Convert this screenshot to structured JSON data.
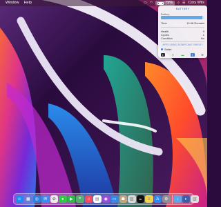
{
  "menubar": {
    "items": [
      "Window",
      "Help"
    ],
    "status": {
      "battery_percent_label": "79%",
      "battery_level": 0.79,
      "user_name": "Cory Wils"
    },
    "icons": [
      "screen-mirroring-icon",
      "wifi-icon",
      "battery-icon",
      "search-icon",
      "control-center-icon"
    ]
  },
  "battery_popover": {
    "title": "BATTERY",
    "charge_label": "Battery",
    "charge_level": 0.96,
    "time_label": "Time",
    "time_value": "10:46 Remaini",
    "health_label": "Health",
    "health_value": "9",
    "cycles_label": "Cycles",
    "cycles_value": "1",
    "condition_label": "Condition",
    "condition_value": "No",
    "link_label": "APPS USING SIGNIFICANT ENERGY",
    "app_name": "Safari",
    "toolbar": [
      "dark-mode-icon",
      "usb-icon",
      "battery-green-icon",
      "bluetooth-icon",
      "settings-icon"
    ]
  },
  "dock": {
    "apps": [
      {
        "name": "finder-icon",
        "color": "#1d8cf0"
      },
      {
        "name": "launchpad-icon",
        "color": "#6a7ad8"
      },
      {
        "name": "safari-icon",
        "color": "#2f7fe0"
      },
      {
        "name": "mail-icon",
        "color": "#3c8de6"
      },
      {
        "name": "photos-icon",
        "color": "#e9e9e9"
      },
      {
        "name": "messages-icon",
        "color": "#33c748"
      },
      {
        "name": "facetime-icon",
        "color": "#2fb84a"
      },
      {
        "name": "maps-icon",
        "color": "#55b06a"
      },
      {
        "name": "music-icon",
        "color": "#f24b5a"
      },
      {
        "name": "calendar-icon",
        "color": "#ffffff"
      },
      {
        "name": "podcasts-icon",
        "color": "#9b4bd8"
      },
      {
        "name": "keynote-icon",
        "color": "#3a86e0"
      },
      {
        "name": "contacts-icon",
        "color": "#c9a27a"
      },
      {
        "name": "preview-icon",
        "color": "#d8d8d8"
      },
      {
        "name": "appletv-icon",
        "color": "#111111",
        "text": "tv"
      },
      {
        "name": "notes-icon",
        "color": "#f5d24a"
      },
      {
        "name": "appstore-icon",
        "color": "#2a8cf0"
      },
      {
        "name": "system-preferences-icon",
        "color": "#8e8e93"
      },
      {
        "name": "downloads-folder-icon",
        "color": "#5aa8e8"
      },
      {
        "name": "screensaver-icon",
        "color": "#3e5fa8"
      },
      {
        "name": "trash-icon",
        "color": "#dedede"
      }
    ]
  }
}
